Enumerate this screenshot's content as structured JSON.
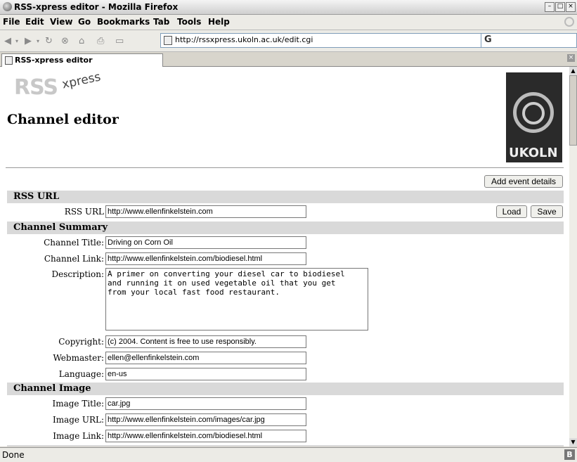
{
  "window": {
    "title": "RSS-xpress editor - Mozilla Firefox"
  },
  "menu": {
    "file": "File",
    "edit": "Edit",
    "view": "View",
    "go": "Go",
    "bookmarks": "Bookmarks",
    "tab": "Tab",
    "tools": "Tools",
    "help": "Help"
  },
  "navbar": {
    "url": "http://rssxpress.ukoln.ac.uk/edit.cgi",
    "search_logo": "G"
  },
  "tab": {
    "label": "RSS-xpress editor"
  },
  "page": {
    "logo_main": "RSS",
    "logo_sub": "xpress",
    "title": "Channel editor",
    "ukoln_logo": "UKOLN",
    "add_event_button": "Add event details",
    "rss_url_section": {
      "header": "RSS URL",
      "label": "RSS URL",
      "value": "http://www.ellenfinkelstein.com",
      "load_button": "Load",
      "save_button": "Save"
    },
    "channel_summary": {
      "header": "Channel Summary",
      "title_label": "Channel Title:",
      "title_value": "Driving on Corn Oil",
      "link_label": "Channel Link:",
      "link_value": "http://www.ellenfinkelstein.com/biodiesel.html",
      "description_label": "Description:",
      "description_value": "A primer on converting your diesel car to biodiesel\nand running it on used vegetable oil that you get\nfrom your local fast food restaurant.",
      "copyright_label": "Copyright:",
      "copyright_value": "(c) 2004. Content is free to use responsibly.",
      "webmaster_label": "Webmaster:",
      "webmaster_value": "ellen@ellenfinkelstein.com",
      "language_label": "Language:",
      "language_value": "en-us"
    },
    "channel_image": {
      "header": "Channel Image",
      "title_label": "Image Title:",
      "title_value": "car.jpg",
      "url_label": "Image URL:",
      "url_value": "http://www.ellenfinkelstein.com/images/car.jpg",
      "link_label": "Image Link:",
      "link_value": "http://www.ellenfinkelstein.com/biodiesel.html"
    }
  },
  "status": {
    "text": "Done",
    "badge": "B"
  }
}
